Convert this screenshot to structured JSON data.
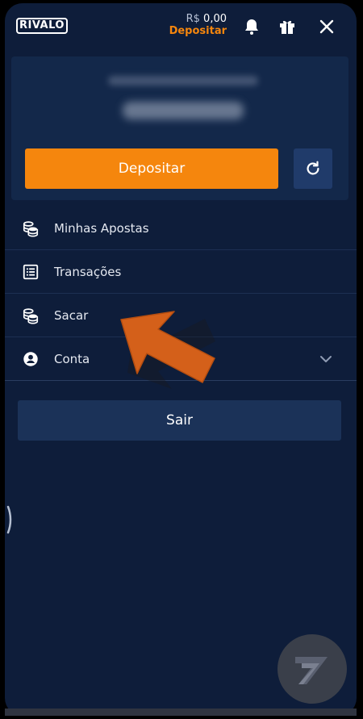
{
  "header": {
    "logo_text": "RIVALO",
    "balance_currency": "R$",
    "balance_amount": "0,00",
    "deposit_link": "Depositar",
    "icons": [
      "bell-icon",
      "gift-icon",
      "close-icon"
    ]
  },
  "wallet": {
    "deposit_button": "Depositar",
    "refresh_icon": "refresh-icon"
  },
  "menu": {
    "items": [
      {
        "label": "Minhas Apostas",
        "icon": "coins-icon"
      },
      {
        "label": "Transações",
        "icon": "list-icon"
      },
      {
        "label": "Sacar",
        "icon": "coins-icon"
      },
      {
        "label": "Conta",
        "icon": "user-circle-icon",
        "expandable": true
      }
    ]
  },
  "logout_button": "Sair",
  "colors": {
    "background": "#0e1d3a",
    "card": "#13284a",
    "accent": "#f5860d",
    "secondary_button": "#1b3258",
    "arrow": "#d4601a"
  }
}
